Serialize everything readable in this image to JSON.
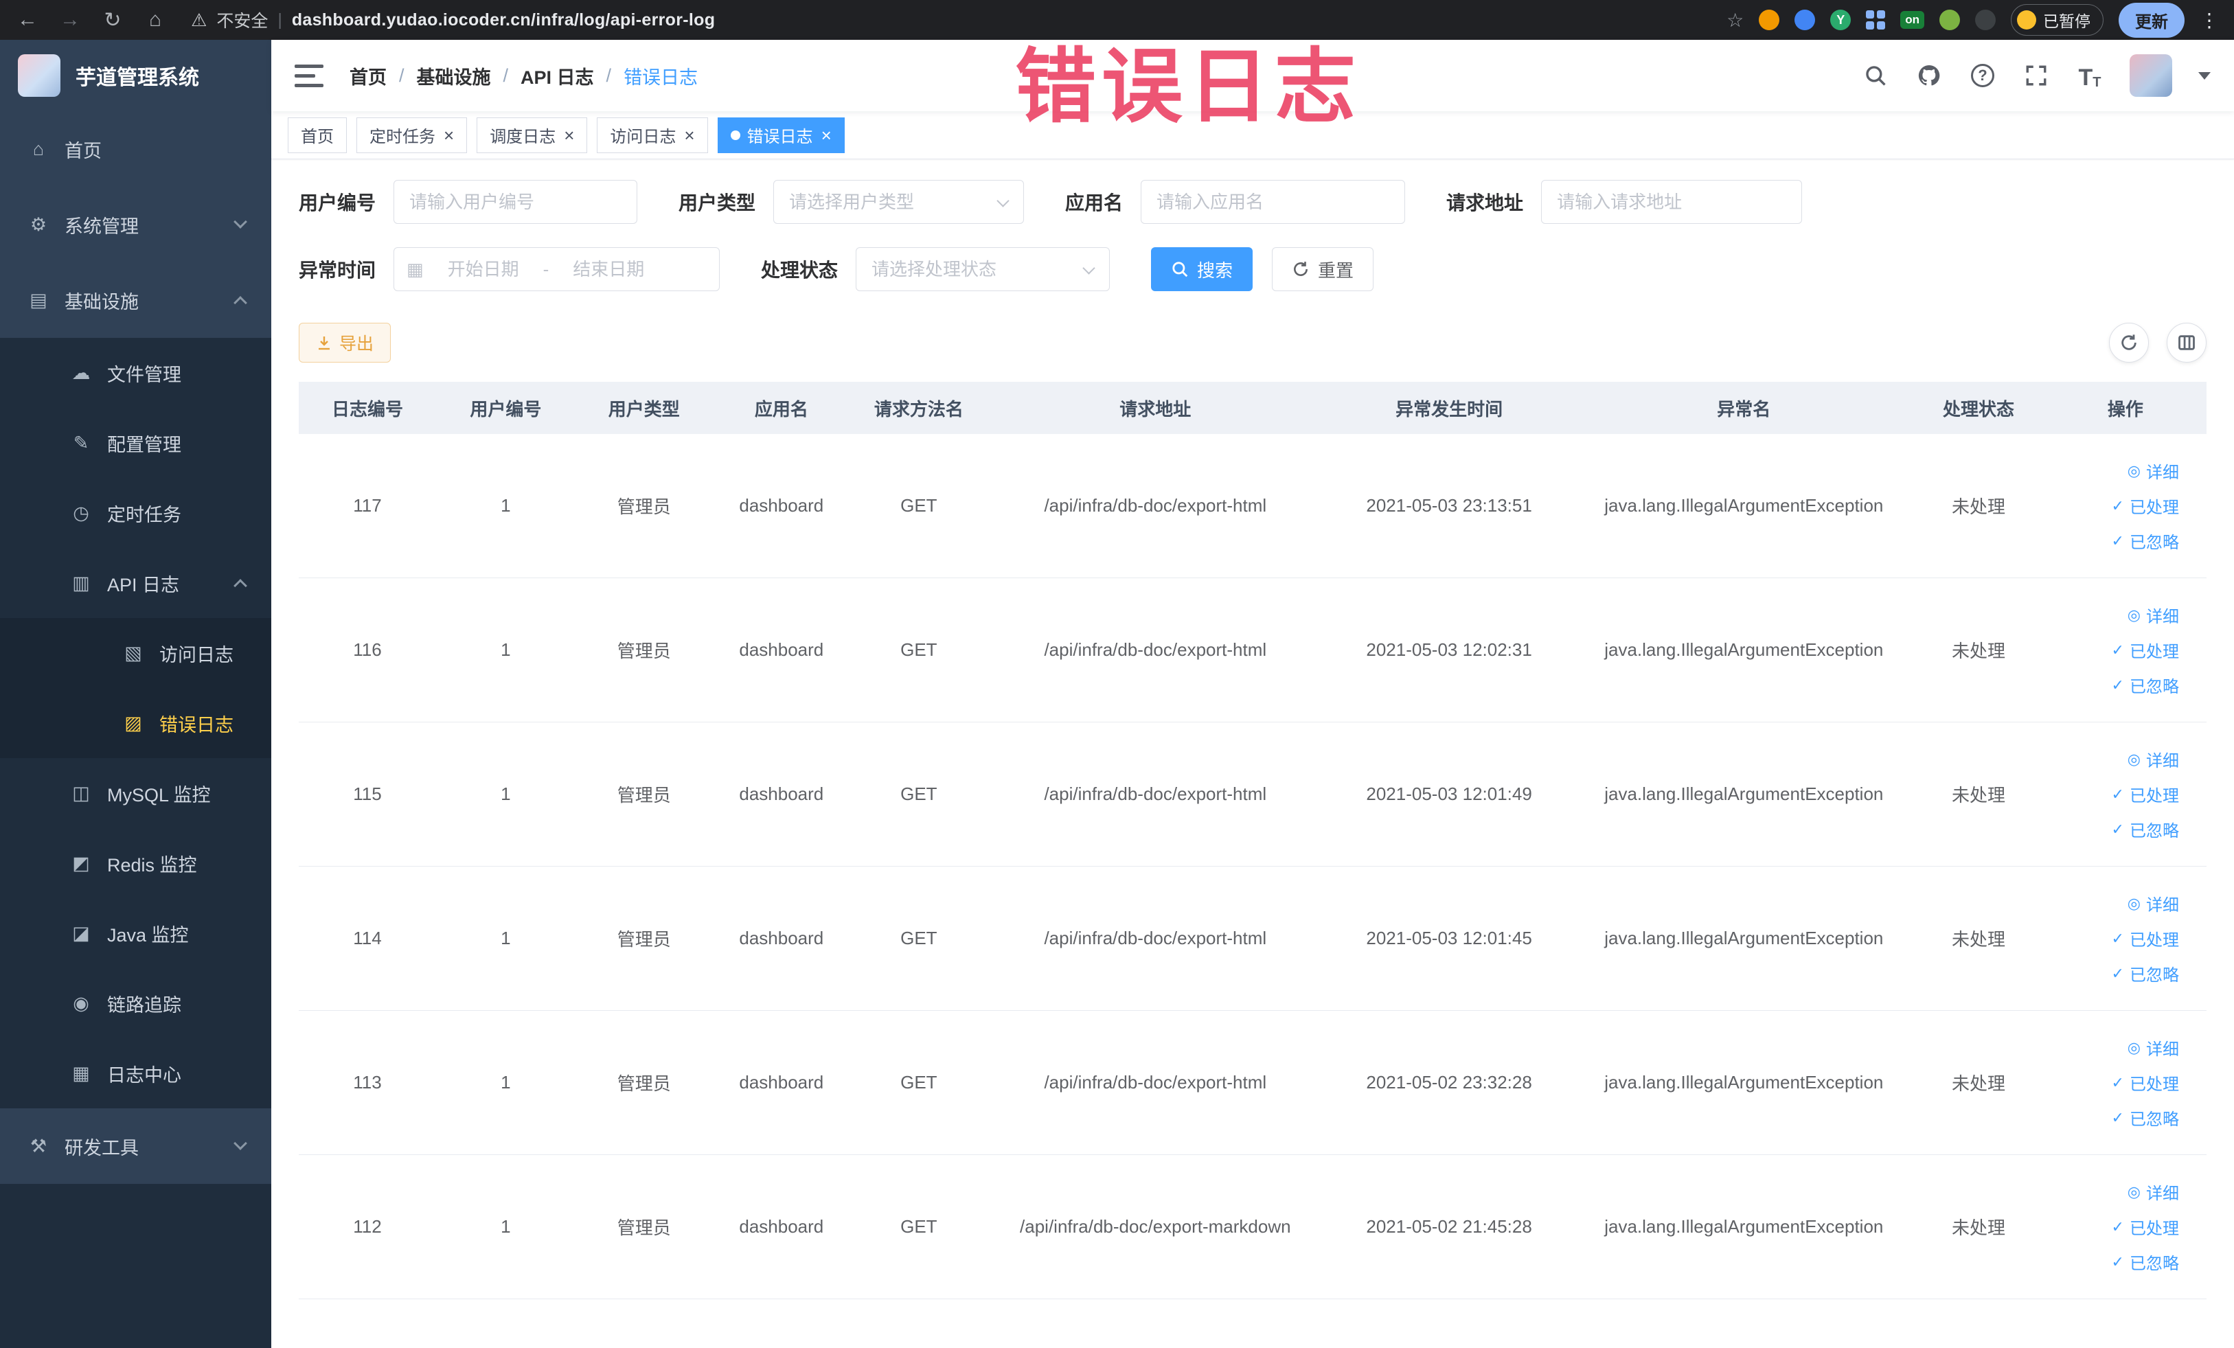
{
  "annotation": {
    "text": "错误日志"
  },
  "browser": {
    "security_label": "不安全",
    "url": "dashboard.yudao.iocoder.cn/infra/log/api-error-log",
    "paused_label": "已暂停",
    "update_label": "更新"
  },
  "app_title": "芋道管理系统",
  "sidebar": {
    "items": [
      {
        "name": "home",
        "label": "首页",
        "icon": "home-icon",
        "level": 1
      },
      {
        "name": "system-management",
        "label": "系统管理",
        "icon": "gear-icon",
        "level": 1,
        "chevron": "down"
      },
      {
        "name": "infrastructure",
        "label": "基础设施",
        "icon": "infrastructure-icon",
        "level": 1,
        "chevron": "up"
      },
      {
        "name": "file-management",
        "label": "文件管理",
        "icon": "file-icon",
        "level": 2
      },
      {
        "name": "config-management",
        "label": "配置管理",
        "icon": "config-icon",
        "level": 2
      },
      {
        "name": "scheduled-tasks",
        "label": "定时任务",
        "icon": "timer-icon",
        "level": 2
      },
      {
        "name": "api-log",
        "label": "API 日志",
        "icon": "api-log-icon",
        "level": 2,
        "chevron": "up"
      },
      {
        "name": "access-log",
        "label": "访问日志",
        "icon": "access-log-icon",
        "level": 3
      },
      {
        "name": "error-log",
        "label": "错误日志",
        "icon": "error-log-icon",
        "level": 3,
        "active": true
      },
      {
        "name": "mysql-monitor",
        "label": "MySQL 监控",
        "icon": "mysql-icon",
        "level": 2
      },
      {
        "name": "redis-monitor",
        "label": "Redis 监控",
        "icon": "redis-icon",
        "level": 2
      },
      {
        "name": "java-monitor",
        "label": "Java 监控",
        "icon": "java-icon",
        "level": 2
      },
      {
        "name": "trace",
        "label": "链路追踪",
        "icon": "trace-icon",
        "level": 2
      },
      {
        "name": "log-center",
        "label": "日志中心",
        "icon": "log-center-icon",
        "level": 2
      },
      {
        "name": "dev-tools",
        "label": "研发工具",
        "icon": "devtools-icon",
        "level": 1,
        "chevron": "down"
      }
    ]
  },
  "header": {
    "breadcrumb": [
      {
        "label": "首页"
      },
      {
        "label": "基础设施"
      },
      {
        "label": "API 日志"
      },
      {
        "label": "错误日志"
      }
    ]
  },
  "tabs": [
    {
      "name": "home",
      "label": "首页",
      "closable": false,
      "active": false
    },
    {
      "name": "timed-task",
      "label": "定时任务",
      "closable": true,
      "active": false
    },
    {
      "name": "schedule-log",
      "label": "调度日志",
      "closable": true,
      "active": false
    },
    {
      "name": "access-log",
      "label": "访问日志",
      "closable": true,
      "active": false
    },
    {
      "name": "error-log",
      "label": "错误日志",
      "closable": true,
      "active": true
    }
  ],
  "filters": {
    "user_id": {
      "label": "用户编号",
      "placeholder": "请输入用户编号"
    },
    "user_type": {
      "label": "用户类型",
      "placeholder": "请选择用户类型"
    },
    "app_name": {
      "label": "应用名",
      "placeholder": "请输入应用名"
    },
    "request_url": {
      "label": "请求地址",
      "placeholder": "请输入请求地址"
    },
    "exception_time": {
      "label": "异常时间",
      "start_placeholder": "开始日期",
      "end_placeholder": "结束日期",
      "separator": "-"
    },
    "process_status": {
      "label": "处理状态",
      "placeholder": "请选择处理状态"
    },
    "search_label": "搜索",
    "reset_label": "重置"
  },
  "toolbar": {
    "export_label": "导出"
  },
  "table": {
    "columns": [
      "日志编号",
      "用户编号",
      "用户类型",
      "应用名",
      "请求方法名",
      "请求地址",
      "异常发生时间",
      "异常名",
      "处理状态",
      "操作"
    ],
    "actions": [
      "详细",
      "已处理",
      "已忽略"
    ],
    "rows": [
      {
        "id": "117",
        "user_id": "1",
        "user_type": "管理员",
        "app": "dashboard",
        "method": "GET",
        "url": "/api/infra/db-doc/export-html",
        "time": "2021-05-03 23:13:51",
        "exception": "java.lang.IllegalArgumentException",
        "status": "未处理"
      },
      {
        "id": "116",
        "user_id": "1",
        "user_type": "管理员",
        "app": "dashboard",
        "method": "GET",
        "url": "/api/infra/db-doc/export-html",
        "time": "2021-05-03 12:02:31",
        "exception": "java.lang.IllegalArgumentException",
        "status": "未处理"
      },
      {
        "id": "115",
        "user_id": "1",
        "user_type": "管理员",
        "app": "dashboard",
        "method": "GET",
        "url": "/api/infra/db-doc/export-html",
        "time": "2021-05-03 12:01:49",
        "exception": "java.lang.IllegalArgumentException",
        "status": "未处理"
      },
      {
        "id": "114",
        "user_id": "1",
        "user_type": "管理员",
        "app": "dashboard",
        "method": "GET",
        "url": "/api/infra/db-doc/export-html",
        "time": "2021-05-03 12:01:45",
        "exception": "java.lang.IllegalArgumentException",
        "status": "未处理"
      },
      {
        "id": "113",
        "user_id": "1",
        "user_type": "管理员",
        "app": "dashboard",
        "method": "GET",
        "url": "/api/infra/db-doc/export-html",
        "time": "2021-05-02 23:32:28",
        "exception": "java.lang.IllegalArgumentException",
        "status": "未处理"
      },
      {
        "id": "112",
        "user_id": "1",
        "user_type": "管理员",
        "app": "dashboard",
        "method": "GET",
        "url": "/api/infra/db-doc/export-markdown",
        "time": "2021-05-02 21:45:28",
        "exception": "java.lang.IllegalArgumentException",
        "status": "未处理"
      }
    ]
  }
}
